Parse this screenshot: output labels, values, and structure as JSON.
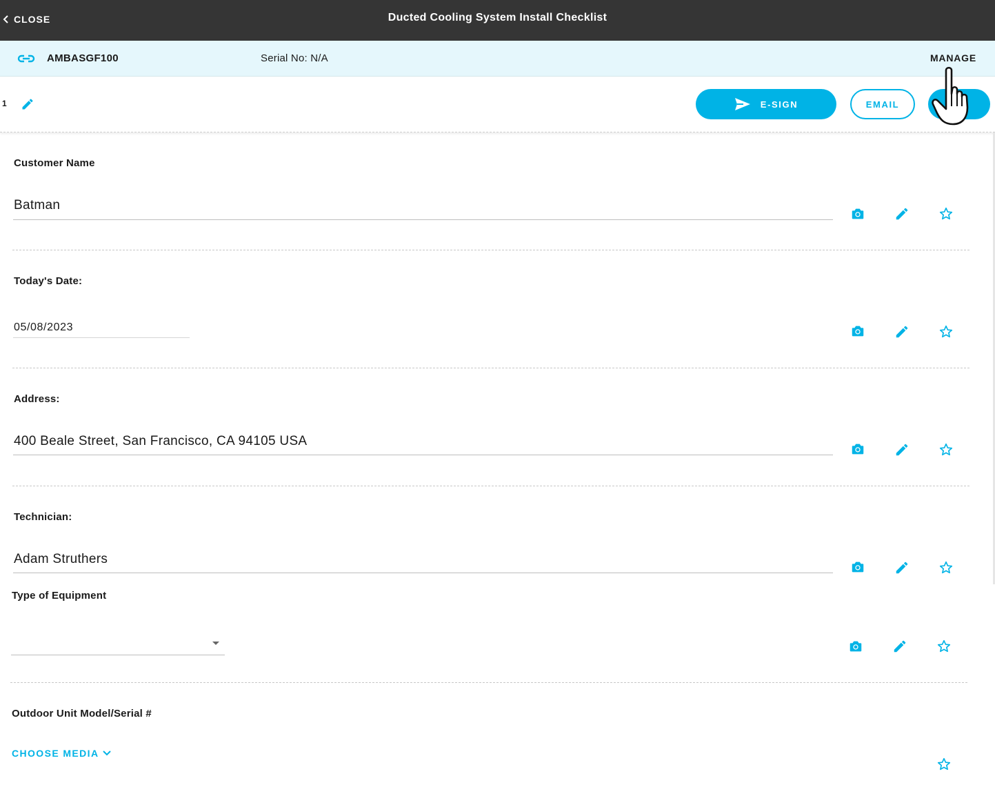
{
  "header": {
    "close_label": "CLOSE",
    "title": "Ducted Cooling System Install Checklist"
  },
  "infobar": {
    "model_code": "AMBASGF100",
    "serial": "Serial No: N/A",
    "manage_label": "MANAGE"
  },
  "actionbar": {
    "page_number": "1",
    "esign_label": "E-SIGN",
    "email_label": "EMAIL"
  },
  "fields": [
    {
      "label": "Customer Name",
      "value": "Batman"
    },
    {
      "label": "Today's Date:",
      "value": "05/08/2023"
    },
    {
      "label": "Address:",
      "value": "400 Beale Street, San Francisco, CA 94105 USA"
    },
    {
      "label": "Technician:",
      "value": "Adam Struthers"
    },
    {
      "label": "Type of Equipment",
      "value": ""
    },
    {
      "label": "Outdoor Unit Model/Serial #",
      "value": ""
    }
  ],
  "choose_media_label": "CHOOSE MEDIA",
  "colors": {
    "accent": "#00b3e6",
    "topbar": "#353535",
    "infobar": "#e5f7fc"
  },
  "icons": [
    "chevron-left-icon",
    "link-icon",
    "pencil-icon",
    "send-icon",
    "camera-icon",
    "star-icon",
    "chevron-down-icon",
    "dropdown-caret-icon",
    "hand-cursor-icon"
  ]
}
